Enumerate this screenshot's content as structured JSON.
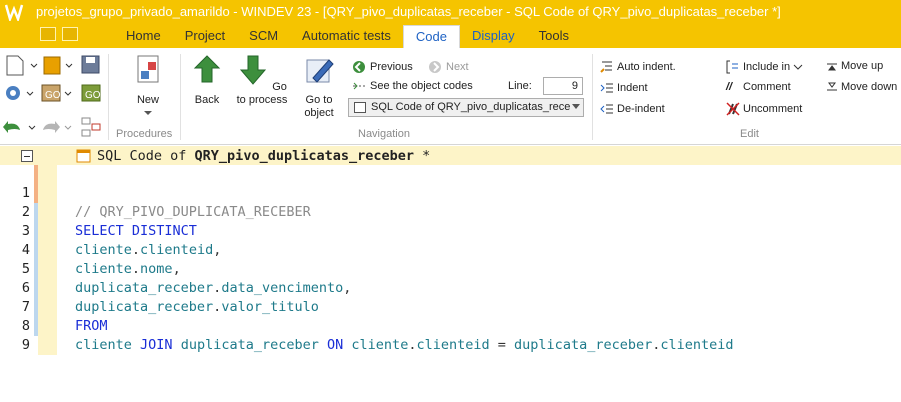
{
  "window": {
    "title": "projetos_grupo_privado_amarildo - WINDEV 23 - [QRY_pivo_duplicatas_receber - SQL Code of QRY_pivo_duplicatas_receber *]"
  },
  "tabs": [
    {
      "label": "Home"
    },
    {
      "label": "Project"
    },
    {
      "label": "SCM"
    },
    {
      "label": "Automatic tests"
    },
    {
      "label": "Code"
    },
    {
      "label": "Display"
    },
    {
      "label": "Tools"
    }
  ],
  "active_tab": "Code",
  "ribbon": {
    "procedures": {
      "new_label": "New",
      "group_label": "Procedures"
    },
    "navigation": {
      "back_label": "Back",
      "goto_process_label": "Go to process",
      "goto_object_label": "Go to object",
      "previous_label": "Previous",
      "next_label": "Next",
      "see_codes_label": "See the object codes",
      "line_label": "Line:",
      "line_value": "9",
      "combo_value": "SQL Code of QRY_pivo_duplicatas_rece",
      "group_label": "Navigation"
    },
    "edit": {
      "auto_indent_label": "Auto indent.",
      "indent_label": "Indent",
      "deindent_label": "De-indent",
      "include_in_label": "Include in",
      "comment_label": "Comment",
      "uncomment_label": "Uncomment",
      "move_up_label": "Move up",
      "move_down_label": "Move down",
      "group_label": "Edit"
    }
  },
  "editor": {
    "header_prefix": "SQL Code of ",
    "header_name": "QRY_pivo_duplicatas_receber",
    "header_suffix": " *",
    "lines": [
      {
        "num": "1",
        "text": "// QRY_PIVO_DUPLICATA_RECEBER"
      },
      {
        "num": "2",
        "text": "SELECT DISTINCT"
      },
      {
        "num": "3",
        "p1": "cliente",
        "p2": ".",
        "p3": "clienteid",
        "p4": ","
      },
      {
        "num": "4",
        "p1": "cliente",
        "p2": ".",
        "p3": "nome",
        "p4": ","
      },
      {
        "num": "5",
        "p1": "duplicata_receber",
        "p2": ".",
        "p3": "data_vencimento",
        "p4": ","
      },
      {
        "num": "6",
        "p1": "duplicata_receber",
        "p2": ".",
        "p3": "valor_titulo",
        "p4": ""
      },
      {
        "num": "7",
        "text": "FROM"
      },
      {
        "num": "8",
        "a": "cliente",
        "b": "JOIN",
        "c": "duplicata_receber",
        "d": "ON",
        "e": "cliente",
        "f": "clienteid",
        "g": "=",
        "h": "duplicata_receber",
        "i": "clienteid"
      },
      {
        "num": "9",
        "text": ""
      }
    ]
  },
  "colors": {
    "title_bar": "#f5c400",
    "keyword": "#1a2ed6",
    "identifier": "#1e7a8a",
    "comment": "#8a8a8a",
    "active_tab_text": "#1e62c4"
  }
}
